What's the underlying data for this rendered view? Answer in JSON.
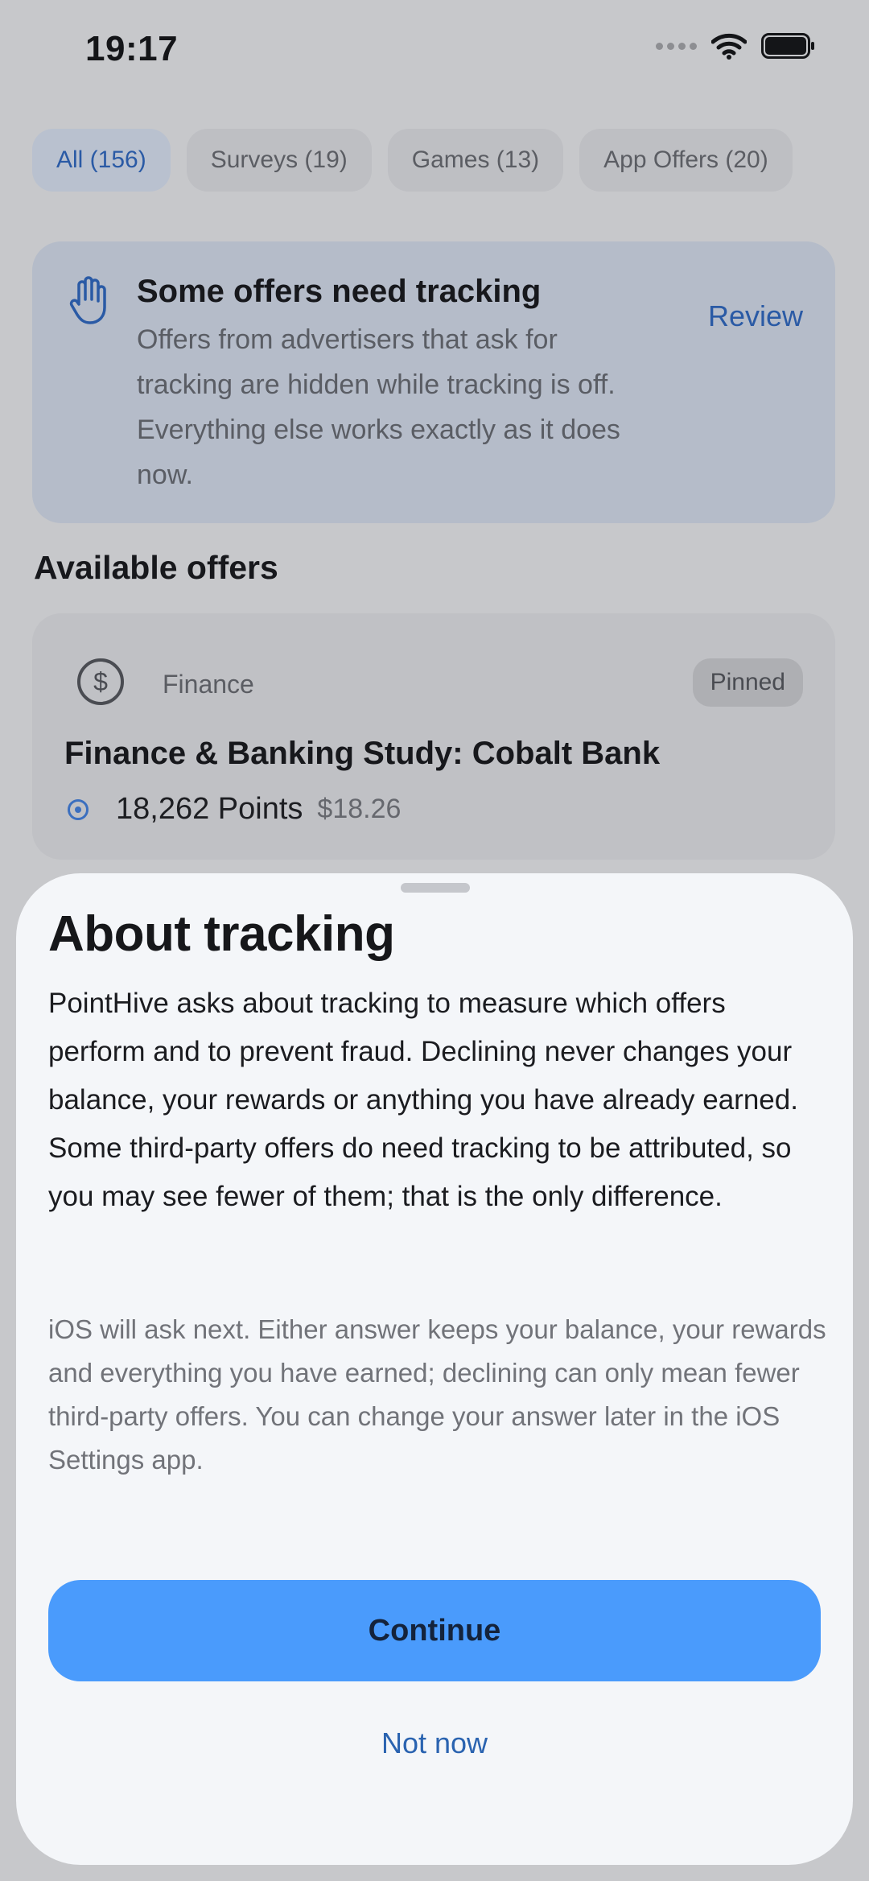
{
  "status_bar": {
    "time": "19:17"
  },
  "filters": [
    {
      "label": "All (156)",
      "active": true
    },
    {
      "label": "Surveys (19)",
      "active": false
    },
    {
      "label": "Games (13)",
      "active": false
    },
    {
      "label": "App Offers (20)",
      "active": false
    }
  ],
  "notice": {
    "title": "Some offers need tracking",
    "body": "Offers from advertisers that ask for tracking are hidden while tracking is off. Everything else works exactly as it does now.",
    "action_label": "Review",
    "icon": "hand-raised-icon"
  },
  "section_title": "Available offers",
  "offer": {
    "category": "Finance",
    "category_icon": "dollar-circle-icon",
    "badge": "Pinned",
    "title": "Finance & Banking Study: Cobalt Bank",
    "points": "18,262 Points",
    "cash": "$18.26"
  },
  "sheet": {
    "title": "About tracking",
    "body": "PointHive asks about tracking to measure which offers perform and to prevent fraud. Declining never changes your balance, your rewards or anything you have already earned. Some third-party offers do need tracking to be attributed, so you may see fewer of them; that is the only difference.",
    "note": "iOS will ask next. Either answer keeps your balance, your rewards and everything you have earned; declining can only mean fewer third-party offers. You can change your answer later in the iOS Settings app.",
    "continue_label": "Continue",
    "not_now_label": "Not now"
  },
  "colors": {
    "accent": "#4a9bfc",
    "link": "#2a63b0",
    "sheet_background": "#f4f6f9",
    "dim_background": "#c7c8cb"
  }
}
